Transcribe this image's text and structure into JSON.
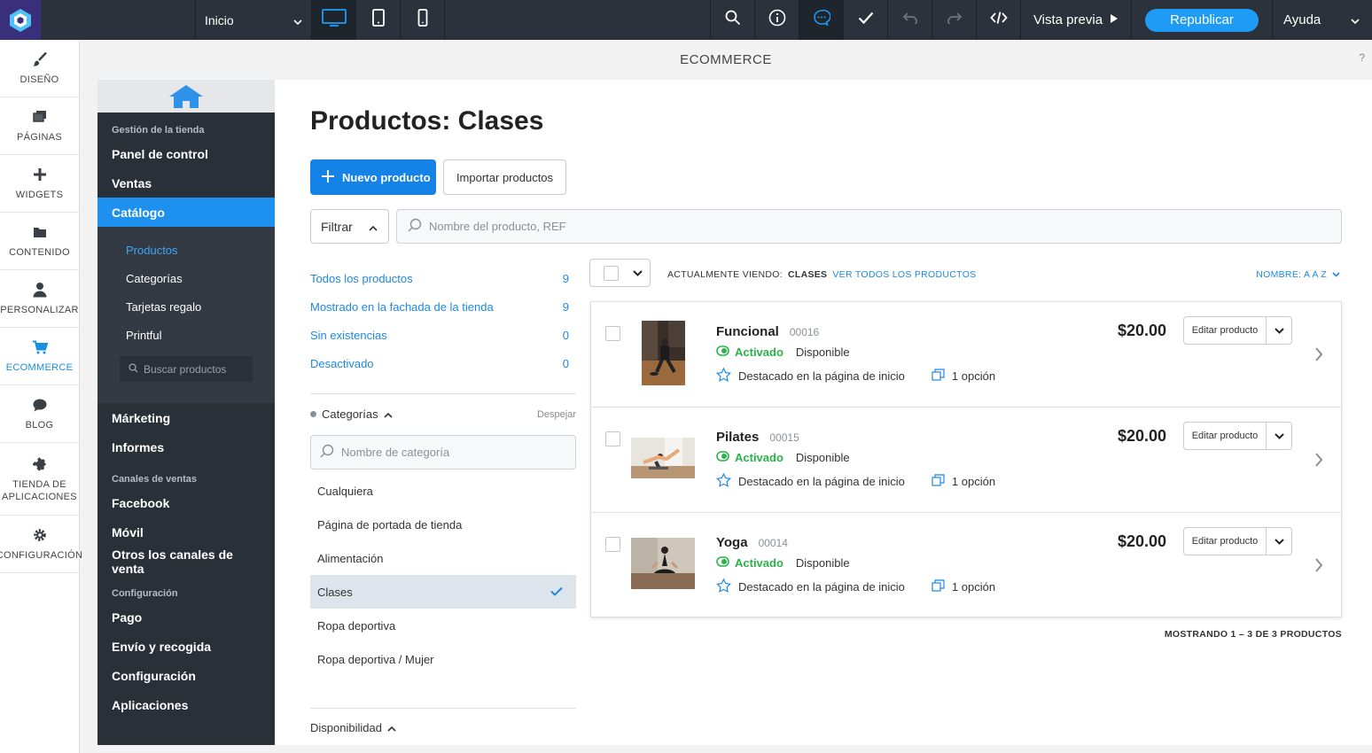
{
  "topbar": {
    "page_select": "Inicio",
    "preview": "Vista previa",
    "publish": "Republicar",
    "help": "Ayuda"
  },
  "rail": {
    "items": [
      {
        "label": "DISEÑO",
        "icon": "brush-icon"
      },
      {
        "label": "PÁGINAS",
        "icon": "pages-icon"
      },
      {
        "label": "WIDGETS",
        "icon": "plus-icon"
      },
      {
        "label": "CONTENIDO",
        "icon": "folder-icon"
      },
      {
        "label": "PERSONALIZAR",
        "icon": "person-icon"
      },
      {
        "label": "ECOMMERCE",
        "icon": "cart-icon"
      },
      {
        "label": "BLOG",
        "icon": "chat-bubble-icon"
      },
      {
        "label": "TIENDA DE APLICACIONES",
        "icon": "puzzle-icon"
      },
      {
        "label": "CONFIGURACIÓN",
        "icon": "gear-icon"
      }
    ]
  },
  "header": {
    "site_label": "ECOMMERCE",
    "help": "?"
  },
  "store_nav": {
    "section_store": "Gestión de la tienda",
    "items_top": [
      "Panel de control",
      "Ventas",
      "Catálogo"
    ],
    "catalog_sub": [
      "Productos",
      "Categorías",
      "Tarjetas regalo",
      "Printful"
    ],
    "search_placeholder": "Buscar productos",
    "items_mid": [
      "Márketing",
      "Informes"
    ],
    "section_channels": "Canales de ventas",
    "channels": [
      "Facebook",
      "Móvil",
      "Otros los canales de venta"
    ],
    "section_config": "Configuración",
    "config": [
      "Pago",
      "Envío y recogida",
      "Configuración",
      "Aplicaciones"
    ]
  },
  "main": {
    "title": "Productos: Clases",
    "new_product": "Nuevo producto",
    "import": "Importar productos",
    "filter": "Filtrar",
    "search_placeholder": "Nombre del producto, REF",
    "filters": [
      {
        "label": "Todos los productos",
        "count": "9"
      },
      {
        "label": "Mostrado en la fachada de la tienda",
        "count": "9"
      },
      {
        "label": "Sin existencias",
        "count": "0"
      },
      {
        "label": "Desactivado",
        "count": "0"
      }
    ],
    "categories_label": "Categorías",
    "clear": "Despejar",
    "category_search_placeholder": "Nombre de categoría",
    "categories": [
      "Cualquiera",
      "Página de portada de tienda",
      "Alimentación",
      "Clases",
      "Ropa deportiva",
      "Ropa deportiva / Mujer"
    ],
    "selected_category_index": 3,
    "availability": "Disponibilidad",
    "viewing_prefix": "ACTUALMENTE VIENDO:",
    "viewing_category": "CLASES",
    "view_all": "VER TODOS LOS PRODUCTOS",
    "sort": "NOMBRE: A A Z",
    "showing": "MOSTRANDO 1 – 3 DE 3 PRODUCTOS"
  },
  "products": [
    {
      "name": "Funcional",
      "sku": "00016",
      "status": "Activado",
      "availability": "Disponible",
      "featured": "Destacado en la página de inicio",
      "options": "1 opción",
      "price": "$20.00",
      "edit": "Editar producto"
    },
    {
      "name": "Pilates",
      "sku": "00015",
      "status": "Activado",
      "availability": "Disponible",
      "featured": "Destacado en la página de inicio",
      "options": "1 opción",
      "price": "$20.00",
      "edit": "Editar producto"
    },
    {
      "name": "Yoga",
      "sku": "00014",
      "status": "Activado",
      "availability": "Disponible",
      "featured": "Destacado en la página de inicio",
      "options": "1 opción",
      "price": "$20.00",
      "edit": "Editar producto"
    }
  ],
  "colors": {
    "accent": "#1e90f0",
    "topbar": "#2b323b",
    "sidebar": "#2a3038",
    "active_green": "#2bb34a"
  }
}
